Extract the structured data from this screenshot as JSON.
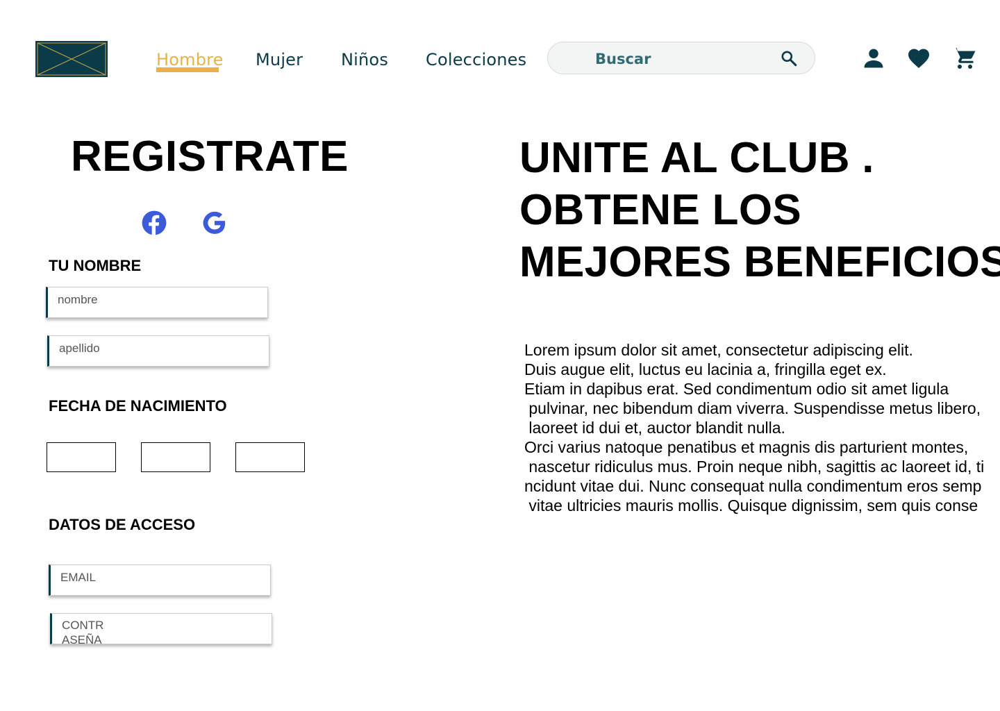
{
  "header": {
    "logo": {
      "icon": "logo-placeholder-icon",
      "bg_color": "#0b3b49",
      "stroke_color": "#c9a64a"
    },
    "nav": [
      {
        "label": "Hombre",
        "active": true
      },
      {
        "label": "Mujer",
        "active": false
      },
      {
        "label": "Niños",
        "active": false
      },
      {
        "label": "Colecciones",
        "active": false
      }
    ],
    "search": {
      "placeholder": "Buscar",
      "icon": "search-icon"
    },
    "icons": [
      "user-icon",
      "heart-icon",
      "cart-icon"
    ],
    "accent_color": "#e6b34a",
    "brand_color": "#0b3b49"
  },
  "register": {
    "title": "REGISTRATE",
    "social": [
      "facebook-icon",
      "google-icon"
    ],
    "name_section": {
      "label": "TU NOMBRE",
      "first_placeholder": "nombre",
      "last_placeholder": "apellido"
    },
    "birth_section": {
      "label": "FECHA DE NACIMIENTO"
    },
    "access_section": {
      "label": "DATOS DE ACCESO",
      "email_placeholder": "EMAIL",
      "password_line1": "CONTR",
      "password_line2": "ASEÑA"
    }
  },
  "promo": {
    "title_lines": [
      "UNITE AL CLUB .",
      "OBTENE LOS",
      "MEJORES BENEFICIOS"
    ],
    "body_lines": [
      "Lorem ipsum dolor sit amet, consectetur adipiscing elit.",
      "Duis augue elit, luctus eu lacinia a, fringilla eget ex.",
      "Etiam in dapibus erat. Sed condimentum odio sit amet ligula",
      " pulvinar, nec bibendum diam viverra. Suspendisse metus libero,",
      " laoreet id dui et, auctor blandit nulla.",
      "Orci varius natoque penatibus et magnis dis parturient montes,",
      " nascetur ridiculus mus. Proin neque nibh, sagittis ac laoreet id, ti",
      "ncidunt vitae dui. Nunc consequat nulla condimentum eros semp",
      " vitae ultricies mauris mollis. Quisque dignissim, sem quis conse"
    ]
  }
}
